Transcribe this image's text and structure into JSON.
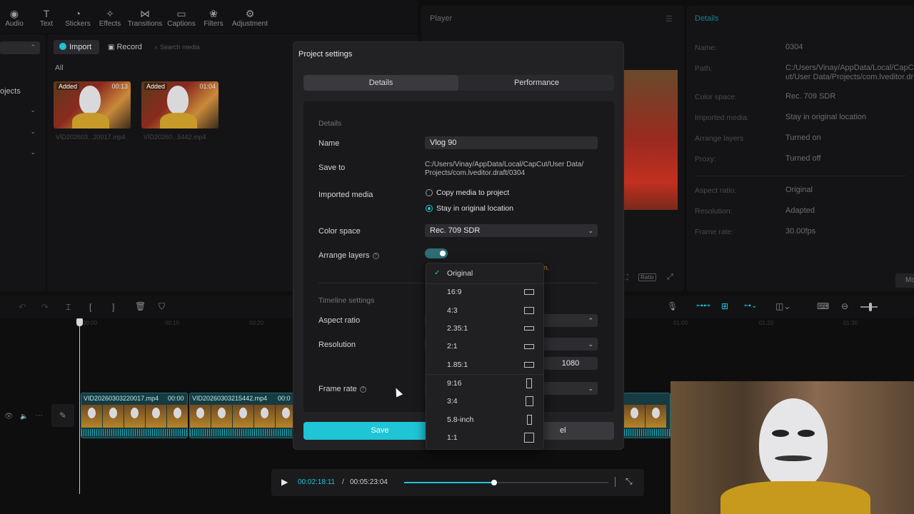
{
  "toolbar": {
    "items": [
      {
        "label": "Audio",
        "icon": "audio-icon"
      },
      {
        "label": "Text",
        "icon": "text-icon"
      },
      {
        "label": "Stickers",
        "icon": "stickers-icon"
      },
      {
        "label": "Effects",
        "icon": "effects-icon"
      },
      {
        "label": "Transitions",
        "icon": "transitions-icon"
      },
      {
        "label": "Captions",
        "icon": "captions-icon"
      },
      {
        "label": "Filters",
        "icon": "filters-icon"
      },
      {
        "label": "Adjustment",
        "icon": "adjustment-icon"
      }
    ]
  },
  "media": {
    "import_label": "Import",
    "record_label": "Record",
    "search_placeholder": "Search media",
    "filter_all": "All",
    "side_label": "ojects",
    "clips": [
      {
        "tag": "Added",
        "duration": "00:13",
        "name": "VID202603...20017.mp4"
      },
      {
        "tag": "Added",
        "duration": "01:04",
        "name": "VID20260...5442.mp4"
      }
    ]
  },
  "player": {
    "title": "Player",
    "ratio_label": "Ratio"
  },
  "details_panel": {
    "title": "Details",
    "rows": [
      {
        "label": "Name:",
        "value": "0304"
      },
      {
        "label": "Path:",
        "value": "C:/Users/Vinay/AppData/Local/CapCut/User Data/Projects/com.lveditor.draft/0304"
      },
      {
        "label": "Color space:",
        "value": "Rec. 709 SDR"
      },
      {
        "label": "Imported media:",
        "value": "Stay in original location"
      },
      {
        "label": "Arrange layers",
        "value": "Turned on"
      },
      {
        "label": "Proxy:",
        "value": "Turned off"
      },
      {
        "label": "Aspect ratio:",
        "value": "Original"
      },
      {
        "label": "Resolution:",
        "value": "Adapted"
      },
      {
        "label": "Frame rate:",
        "value": "30.00fps"
      }
    ],
    "more_label": "Mo"
  },
  "modal": {
    "title": "Project settings",
    "tabs": [
      "Details",
      "Performance"
    ],
    "section_details": "Details",
    "name_label": "Name",
    "name_value": "Vlog 90",
    "save_to_label": "Save to",
    "save_to_value_1": "C:/Users/Vinay/AppData/Local/CapCut/User Data/",
    "save_to_value_2": "Projects/com.lveditor.draft/0304",
    "imported_media_label": "Imported media",
    "imported_options": [
      "Copy media to project",
      "Stay in original location"
    ],
    "color_space_label": "Color space",
    "color_space_value": "Rec. 709 SDR",
    "arrange_layers_label": "Arrange layers",
    "arrange_hint": "n.",
    "section_timeline": "Timeline settings",
    "aspect_ratio_label": "Aspect ratio",
    "resolution_label": "Resolution",
    "resolution_height": "1080",
    "frame_rate_label": "Frame rate",
    "save_label": "Save",
    "cancel_label": "el"
  },
  "aspect_dropdown": {
    "selected": "Original",
    "options": [
      "Original",
      "16:9",
      "4:3",
      "2.35:1",
      "2:1",
      "1.85:1",
      "9:16",
      "3:4",
      "5.8-inch",
      "1:1"
    ]
  },
  "timeline": {
    "ticks": [
      "00:00",
      "00:10",
      "00:20"
    ],
    "ticks_right": [
      "01:00",
      "01:20",
      "01:30"
    ],
    "clip1": "VID20260303220017.mp4",
    "clip1_time": "00:00",
    "clip2": "VID20260303215442.mp4",
    "clip2_time": "00:0"
  },
  "playback": {
    "current": "00:02:18:11",
    "separator": "/",
    "total": "00:05:23:04",
    "progress": 0.44
  },
  "colors": {
    "accent": "#1fc4d6",
    "warning": "#d29a2a"
  }
}
